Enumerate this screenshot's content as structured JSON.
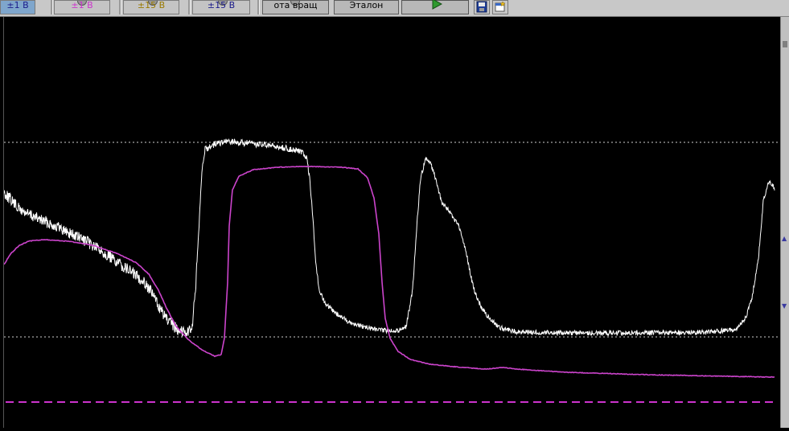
{
  "toolbar": {
    "ch1_range": "±1 В",
    "ch2_range": "±1 В",
    "ch3_range": "±15 В",
    "ch4_range": "±15 В",
    "rotation_button": "ота вращ",
    "etalon_button": "Эталон",
    "run_icon": "play-icon",
    "save_icon": "floppy-save-icon",
    "add_window_icon": "add-window-icon",
    "colors": {
      "ch1": "#1a1a8a",
      "ch2": "#cc33cc",
      "ch3": "#c8a000",
      "ch4": "#1a1a8a"
    }
  },
  "plot": {
    "background": "#000000",
    "trace_white_color": "#ffffff",
    "trace_magenta_color": "#cc44cc",
    "ref_line_color": "#cfcfcf",
    "bottom_dashed_color": "#cc33cc"
  }
}
